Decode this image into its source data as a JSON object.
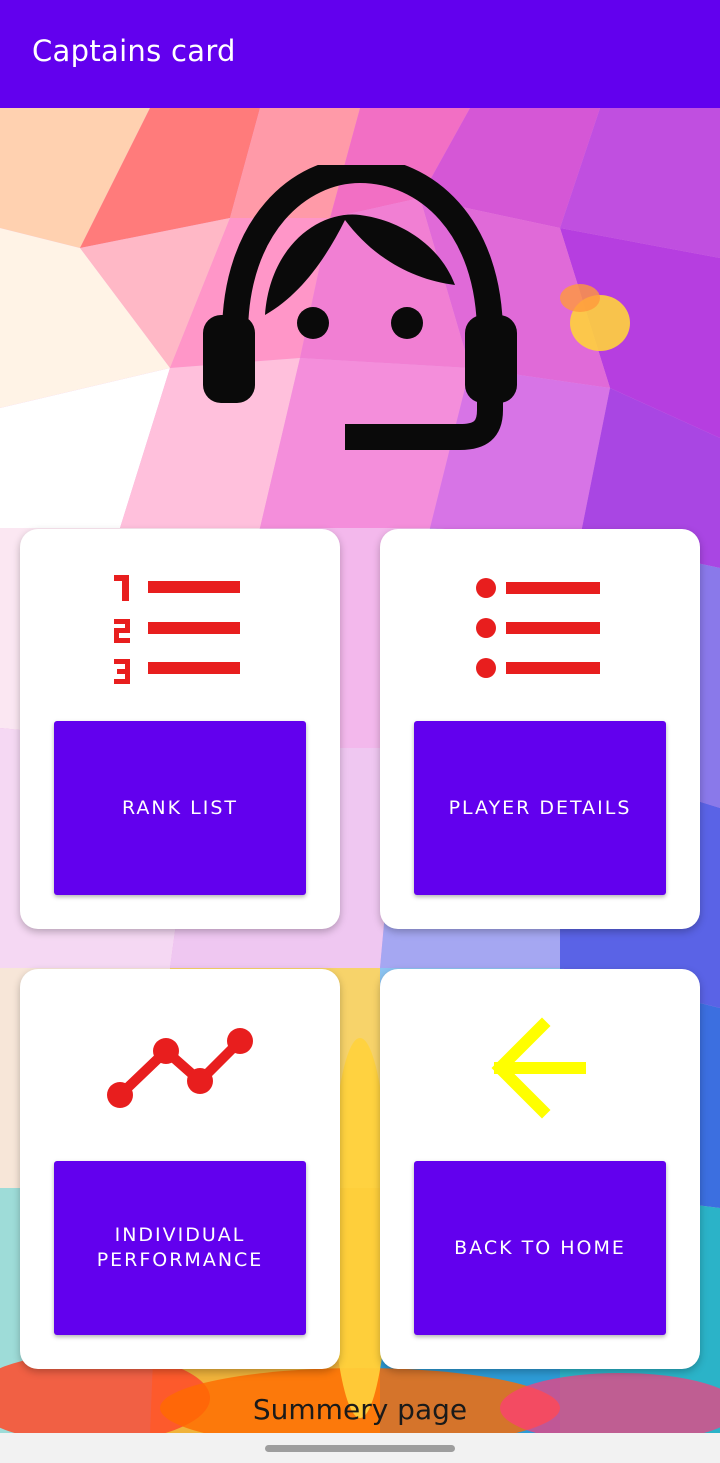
{
  "app_bar": {
    "title": "Captains card"
  },
  "header": {
    "icon": "support-agent-icon"
  },
  "cards": [
    {
      "icon": "format-list-numbered-icon",
      "button_label": "RANK LIST"
    },
    {
      "icon": "format-list-bulleted-icon",
      "button_label": "PLAYER DETAILS"
    },
    {
      "icon": "trending-line-icon",
      "button_label": "INDIVIDUAL PERFORMANCE"
    },
    {
      "icon": "arrow-back-icon",
      "button_label": "BACK TO HOME"
    }
  ],
  "footer": {
    "label": "Summery page"
  },
  "colors": {
    "primary": "#6200ee",
    "icon_red": "#e81e1e",
    "icon_yellow": "#ffff00",
    "card_bg": "#ffffff"
  }
}
